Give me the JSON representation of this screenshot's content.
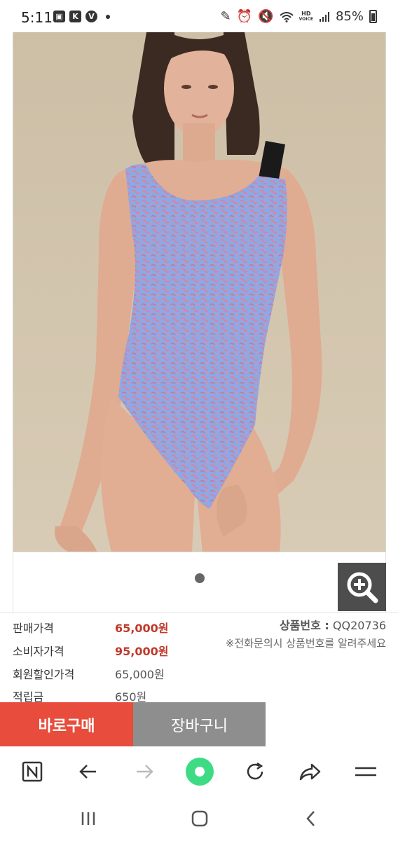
{
  "status_bar": {
    "time": "5:11",
    "left_icons": [
      "gallery-icon",
      "k-app-icon",
      "v-app-icon"
    ],
    "right_icons": [
      "pen-icon",
      "alarm-icon",
      "mute-icon",
      "wifi-icon",
      "hd-voice-icon",
      "signal-icon"
    ],
    "hd_label": "HD",
    "voice_label": "VOICE",
    "battery": "85%"
  },
  "product": {
    "image_alt": "swimsuit-product-photo",
    "carousel_active_index": 1,
    "carousel_total": 1
  },
  "price_info": {
    "rows": [
      {
        "label": "판매가격",
        "value": "65,000원"
      },
      {
        "label": "소비자가격",
        "value": "95,000원"
      },
      {
        "label": "회원할인가격",
        "value": "65,000원"
      },
      {
        "label": "적립금",
        "value": "650원"
      }
    ],
    "product_code_label": "상품번호 :",
    "product_code": "QQ20736",
    "call_note": "※전화문의시 상품번호를 알려주세요"
  },
  "actions": {
    "buy_now": "바로구매",
    "cart": "장바구니"
  },
  "browser_toolbar": {
    "items": [
      "home-n-icon",
      "back-icon",
      "forward-icon",
      "menu-dot-icon",
      "reload-icon",
      "share-icon",
      "hamburger-icon"
    ]
  },
  "colors": {
    "buy_now_bg": "#e74c3c",
    "cart_bg": "#8e8e8e",
    "price_red": "#c0392b",
    "toolbar_green": "#3ddc84"
  }
}
